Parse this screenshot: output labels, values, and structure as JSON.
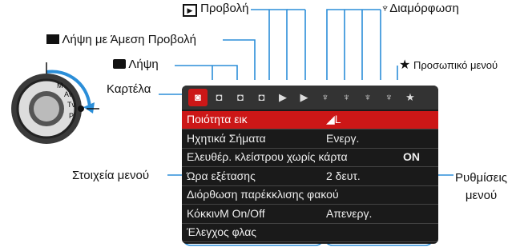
{
  "callouts": {
    "playback": "Προβολή",
    "setup": "Διαμόρφωση",
    "liveview": "Λήψη με Άμεση Προβολή",
    "shooting": "Λήψη",
    "mymenu": "Προσωπικό μενού",
    "tab": "Καρτέλα",
    "items": "Στοιχεία μενού",
    "settings_1": "Ρυθμίσεις",
    "settings_2": "μενού"
  },
  "tabs": [
    {
      "icon": "camera-icon",
      "glyph": "◙",
      "active": true
    },
    {
      "icon": "camera-icon",
      "glyph": "◘"
    },
    {
      "icon": "camera-icon",
      "glyph": "◘"
    },
    {
      "icon": "liveview-icon",
      "glyph": "◘"
    },
    {
      "icon": "playback-icon",
      "glyph": "▶"
    },
    {
      "icon": "playback-icon",
      "glyph": "▶"
    },
    {
      "icon": "wrench-icon",
      "glyph": "♆"
    },
    {
      "icon": "wrench-icon",
      "glyph": "♆"
    },
    {
      "icon": "wrench-icon",
      "glyph": "♆"
    },
    {
      "icon": "wrench-icon",
      "glyph": "♆"
    },
    {
      "icon": "star-icon",
      "glyph": "★"
    }
  ],
  "menu": [
    {
      "label": "Ποιότητα εικ",
      "value": "◢L",
      "value2": "",
      "selected": true
    },
    {
      "label": "Ηχητικά Σήματα",
      "value": "Ενεργ.",
      "value2": ""
    },
    {
      "label": "Ελευθέρ. κλείστρου χωρίς κάρτα",
      "value": "",
      "value2": "ON"
    },
    {
      "label": "Ώρα εξέτασης",
      "value": "2 δευτ.",
      "value2": ""
    },
    {
      "label": "Διόρθωση παρέκκλισης φακού",
      "value": "",
      "value2": ""
    },
    {
      "label": "ΚόκκινΜ On/Off",
      "value": "Απενεργ.",
      "value2": ""
    },
    {
      "label": "Έλεγχος φλας",
      "value": "",
      "value2": ""
    }
  ],
  "colors": {
    "accent": "#2b8ed8",
    "selected": "#cc1717"
  }
}
